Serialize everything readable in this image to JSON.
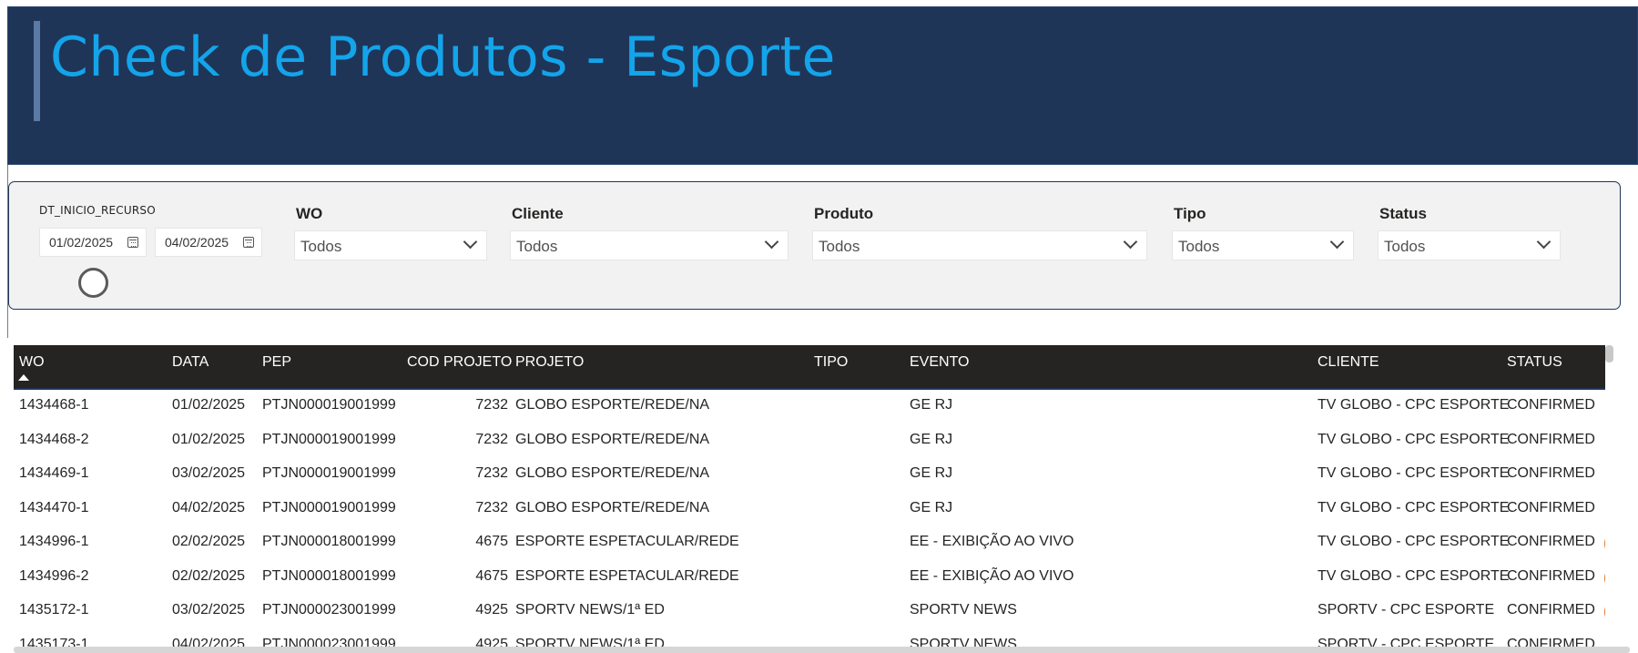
{
  "header": {
    "title": "Check de Produtos - Esporte"
  },
  "filters": {
    "date_label": "DT_INICIO_RECURSO",
    "date_start": "01/02/2025",
    "date_end": "04/02/2025",
    "slicers": [
      {
        "label": "WO",
        "value": "Todos"
      },
      {
        "label": "Cliente",
        "value": "Todos"
      },
      {
        "label": "Produto",
        "value": "Todos"
      },
      {
        "label": "Tipo",
        "value": "Todos"
      },
      {
        "label": "Status",
        "value": "Todos"
      }
    ]
  },
  "table": {
    "columns": [
      "WO",
      "DATA",
      "PEP",
      "COD PROJETO",
      "PROJETO",
      "TIPO",
      "EVENTO",
      "CLIENTE",
      "STATUS"
    ],
    "sorted_column": "WO",
    "sort_direction": "ascending",
    "status_mark_color": "#e07a2f",
    "rows": [
      {
        "wo": "1434468-1",
        "data": "01/02/2025",
        "pep": "PTJN000019001999",
        "cod": "7232",
        "projeto": "GLOBO ESPORTE/REDE/NA",
        "tipo": "",
        "evento": "GE RJ",
        "cliente": "TV GLOBO - CPC ESPORTE",
        "status": "CONFIRMED"
      },
      {
        "wo": "1434468-2",
        "data": "01/02/2025",
        "pep": "PTJN000019001999",
        "cod": "7232",
        "projeto": "GLOBO ESPORTE/REDE/NA",
        "tipo": "",
        "evento": "GE RJ",
        "cliente": "TV GLOBO - CPC ESPORTE",
        "status": "CONFIRMED"
      },
      {
        "wo": "1434469-1",
        "data": "03/02/2025",
        "pep": "PTJN000019001999",
        "cod": "7232",
        "projeto": "GLOBO ESPORTE/REDE/NA",
        "tipo": "",
        "evento": "GE RJ",
        "cliente": "TV GLOBO - CPC ESPORTE",
        "status": "CONFIRMED"
      },
      {
        "wo": "1434470-1",
        "data": "04/02/2025",
        "pep": "PTJN000019001999",
        "cod": "7232",
        "projeto": "GLOBO ESPORTE/REDE/NA",
        "tipo": "",
        "evento": "GE RJ",
        "cliente": "TV GLOBO - CPC ESPORTE",
        "status": "CONFIRMED"
      },
      {
        "wo": "1434996-1",
        "data": "02/02/2025",
        "pep": "PTJN000018001999",
        "cod": "4675",
        "projeto": "ESPORTE ESPETACULAR/REDE",
        "tipo": "",
        "evento": "EE - EXIBIÇÃO AO VIVO",
        "cliente": "TV GLOBO - CPC ESPORTE",
        "status": "CONFIRMED"
      },
      {
        "wo": "1434996-2",
        "data": "02/02/2025",
        "pep": "PTJN000018001999",
        "cod": "4675",
        "projeto": "ESPORTE ESPETACULAR/REDE",
        "tipo": "",
        "evento": "EE - EXIBIÇÃO AO VIVO",
        "cliente": "TV GLOBO - CPC ESPORTE",
        "status": "CONFIRMED"
      },
      {
        "wo": "1435172-1",
        "data": "03/02/2025",
        "pep": "PTJN000023001999",
        "cod": "4925",
        "projeto": "SPORTV NEWS/1ª ED",
        "tipo": "",
        "evento": "SPORTV NEWS",
        "cliente": "SPORTV - CPC ESPORTE",
        "status": "CONFIRMED"
      },
      {
        "wo": "1435173-1",
        "data": "04/02/2025",
        "pep": "PTJN000023001999",
        "cod": "4925",
        "projeto": "SPORTV NEWS/1ª ED",
        "tipo": "",
        "evento": "SPORTV NEWS",
        "cliente": "SPORTV - CPC ESPORTE",
        "status": "CONFIRMED"
      }
    ]
  }
}
